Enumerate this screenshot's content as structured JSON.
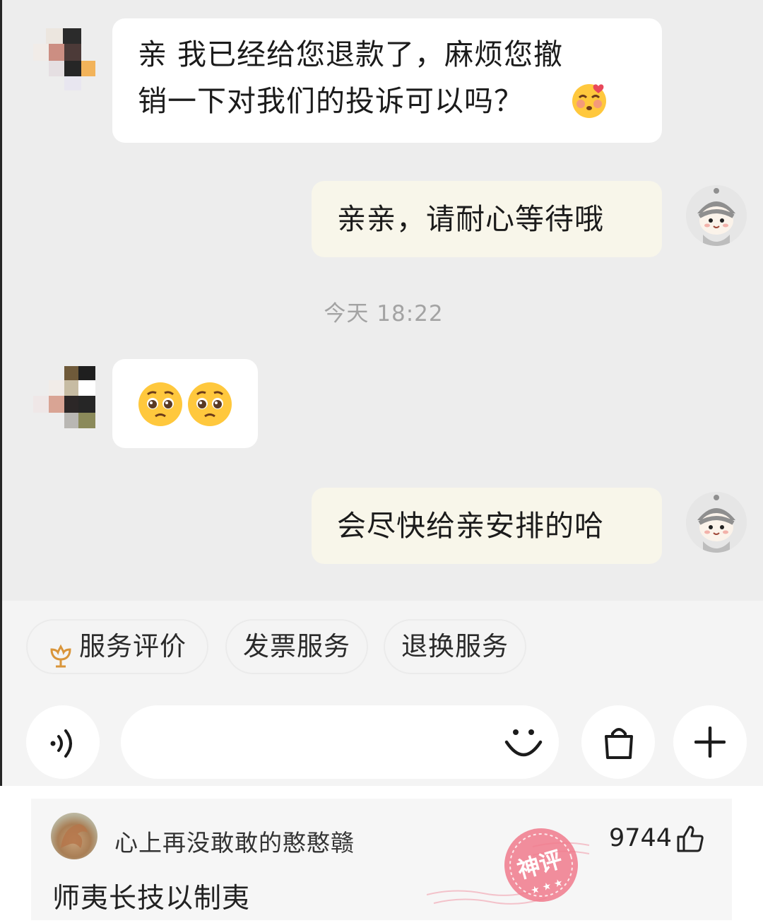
{
  "messages": [
    {
      "side": "in",
      "lines": [
        "亲 我已经给您退款了，麻烦您撤",
        "销一下对我们的投诉可以吗？"
      ],
      "emoji": "blushing-smile-emoji"
    },
    {
      "side": "out",
      "text": "亲亲，请耐心等待哦"
    },
    {
      "side": "in",
      "emoji": "pleading-face-emoji x2"
    },
    {
      "side": "out",
      "text": "会尽快给亲安排的哈"
    }
  ],
  "timestamp": "今天 18:22",
  "quick_actions": [
    "服务评价",
    "发票服务",
    "退换服务"
  ],
  "icons": {
    "service": "flower-icon",
    "voice": "voice-icon",
    "emoji": "smiley-icon",
    "shop": "shopping-bag-icon",
    "more": "plus-icon",
    "like": "thumbs-up-icon",
    "stamp": "shenping-stamp-icon"
  },
  "comment": {
    "username": "心上再没敢敢的憨憨赣",
    "likes": "9744",
    "text": "师夷长技以制夷",
    "stamp_text": "神评"
  },
  "colors": {
    "chat_bg": "#ededed",
    "incoming_bubble": "#ffffff",
    "outgoing_bubble": "#f8f6ea",
    "timestamp": "#a3a3a3",
    "stamp": "#f07a8c"
  }
}
